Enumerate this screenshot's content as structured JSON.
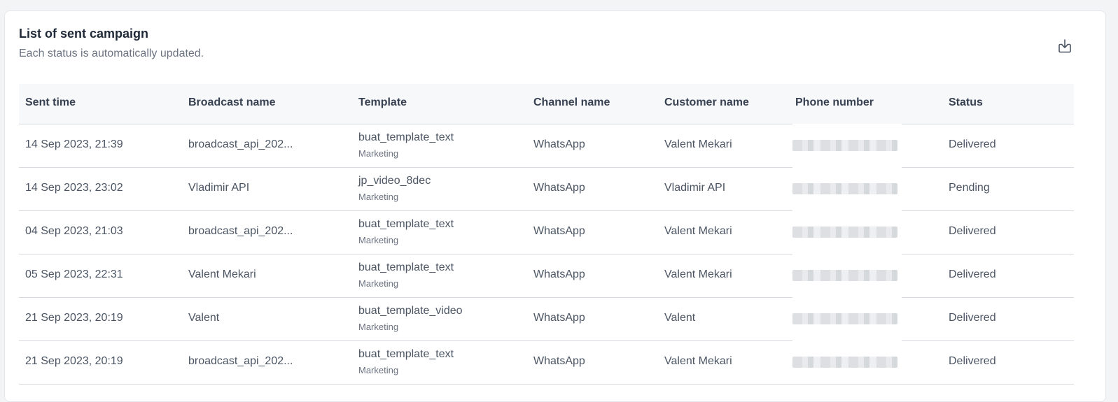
{
  "card": {
    "title": "List of sent campaign",
    "subtitle": "Each status is automatically updated.",
    "download_icon": "download-icon"
  },
  "table": {
    "columns": [
      "Sent time",
      "Broadcast name",
      "Template",
      "Channel name",
      "Customer name",
      "Phone number",
      "Status"
    ],
    "rows": [
      {
        "sent_time": "14 Sep 2023, 21:39",
        "broadcast": "broadcast_api_202...",
        "template": "buat_template_text",
        "category": "Marketing",
        "channel": "WhatsApp",
        "customer": "Valent Mekari",
        "status": "Delivered"
      },
      {
        "sent_time": "14 Sep 2023, 23:02",
        "broadcast": "Vladimir API",
        "template": "jp_video_8dec",
        "category": "Marketing",
        "channel": "WhatsApp",
        "customer": "Vladimir API",
        "status": "Pending"
      },
      {
        "sent_time": "04 Sep 2023, 21:03",
        "broadcast": "broadcast_api_202...",
        "template": "buat_template_text",
        "category": "Marketing",
        "channel": "WhatsApp",
        "customer": "Valent Mekari",
        "status": "Delivered"
      },
      {
        "sent_time": "05 Sep 2023, 22:31",
        "broadcast": "Valent Mekari",
        "template": "buat_template_text",
        "category": "Marketing",
        "channel": "WhatsApp",
        "customer": "Valent Mekari",
        "status": "Delivered"
      },
      {
        "sent_time": "21 Sep 2023, 20:19",
        "broadcast": "Valent",
        "template": "buat_template_video",
        "category": "Marketing",
        "channel": "WhatsApp",
        "customer": "Valent",
        "status": "Delivered"
      },
      {
        "sent_time": "21 Sep 2023, 20:19",
        "broadcast": "broadcast_api_202...",
        "template": "buat_template_text",
        "category": "Marketing",
        "channel": "WhatsApp",
        "customer": "Valent Mekari",
        "status": "Delivered"
      }
    ]
  }
}
